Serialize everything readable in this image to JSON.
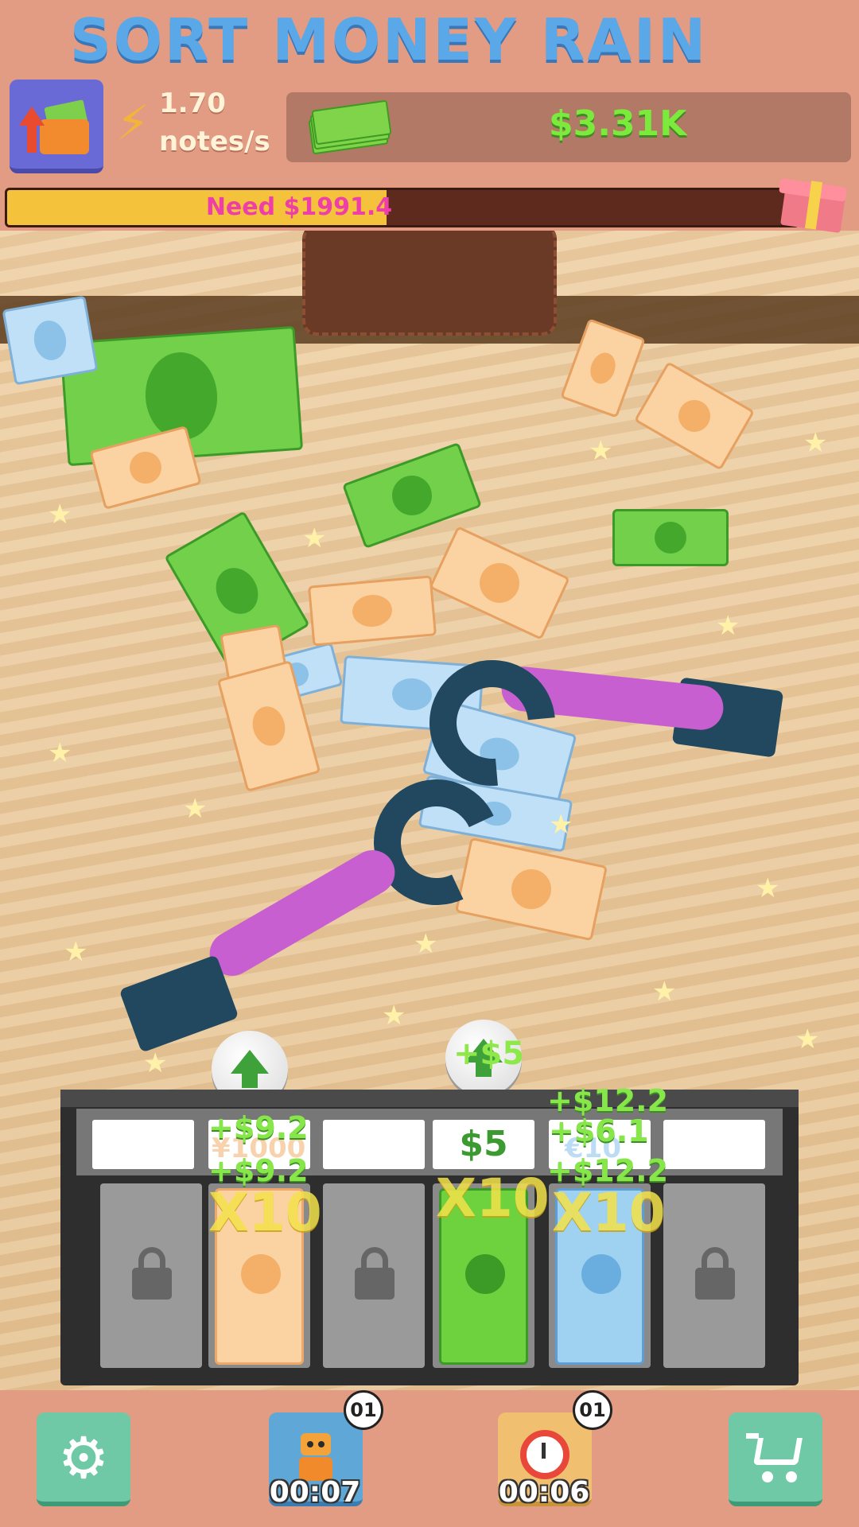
{
  "game": {
    "title": "SORT MONEY RAIN"
  },
  "stats": {
    "rate_value": "1.70",
    "rate_unit": "notes/s",
    "money": "$3.31K"
  },
  "progress": {
    "label": "Need $1991.4",
    "fraction": 0.48
  },
  "register": {
    "labels": [
      "",
      "",
      "",
      "$5",
      "",
      ""
    ],
    "slots": [
      {
        "state": "locked"
      },
      {
        "state": "filled",
        "currency": "yen",
        "multiplier": "X10"
      },
      {
        "state": "locked"
      },
      {
        "state": "filled",
        "currency": "dollar",
        "multiplier": "X10"
      },
      {
        "state": "filled",
        "currency": "euro",
        "multiplier": "X10"
      },
      {
        "state": "locked"
      }
    ],
    "floating": [
      "+$9.2",
      "+$9.2",
      "+$12.2",
      "+$6.1",
      "+$12.2"
    ],
    "ghost_labels": [
      "¥1000",
      "€10"
    ],
    "bubble_text": "+$5"
  },
  "bottom_bar": {
    "robot": {
      "badge": "01",
      "timer": "00:07"
    },
    "boost": {
      "badge": "01",
      "timer": "00:06"
    }
  },
  "colors": {
    "accent": "#e39c84",
    "money": "#7bea3c",
    "progress": "#f5c33b",
    "need_text": "#ee3fa8"
  },
  "icons": [
    "wallet-upgrade-icon",
    "lightning-bolt-icon",
    "cash-stack-icon",
    "gift-icon",
    "upgrade-arrow-icon",
    "lock-icon",
    "gear-icon",
    "robot-icon",
    "stopwatch-x10-icon",
    "shopping-cart-icon"
  ]
}
